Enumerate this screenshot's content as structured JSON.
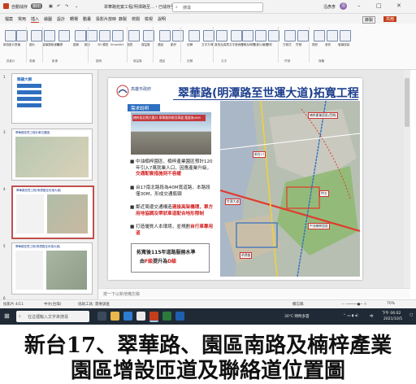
{
  "titlebar": {
    "autosave": "自動儲存",
    "toggle": "關閉",
    "doc_title": "翠華路拓寬工程(明潭路至…・已儲存至 此電腦",
    "search_placeholder": "搜尋",
    "user": "沿彥彥",
    "user_initials": "沿"
  },
  "menu": {
    "tabs": [
      "檔案",
      "常用",
      "插入",
      "繪圖",
      "設計",
      "轉場",
      "動畫",
      "投影片放映",
      "錄製",
      "校閱",
      "檢視",
      "說明"
    ],
    "right": "錄製",
    "share": "共用"
  },
  "ribbon": {
    "buttons": [
      "新投影片",
      "表格",
      "圖片",
      "螢幕擷取畫面",
      "相簿",
      "圖案",
      "圖示",
      "3D 模型",
      "SmartArt",
      "圖表",
      "增益集",
      "連結",
      "動作",
      "註解",
      "文字方塊",
      "頁首及頁尾",
      "文字藝術師",
      "日期及時間",
      "投影片編號",
      "物件",
      "方程式",
      "符號",
      "視訊",
      "音訊",
      "螢幕錄製"
    ],
    "groups": [
      "投影片",
      "表格",
      "影像",
      "圖例",
      "增益集",
      "連結",
      "註解",
      "文字",
      "符號",
      "媒體"
    ]
  },
  "thumbnails": [
    {
      "num": "1",
      "title": "競鐵大綱"
    },
    {
      "num": "3",
      "title": "翠華路拓寬工程計畫位置圖"
    },
    {
      "num": "4",
      "title": "翠華路拓寬工程(明潭路至世運大道)"
    },
    {
      "num": "5",
      "title": "翠華路拓寬工程(明潭路至世運大道)"
    },
    {
      "num": "6",
      "title": ""
    }
  ],
  "slide": {
    "logo_text": "高雄市政府",
    "title": "翠華路(明潭路至世運大道)拓寬工程",
    "section": "需求說明",
    "photo_caption": "楠梓段北側大路口 翠華路與現況車道 寬度為40M",
    "bullets": [
      {
        "text": "中油楠梓園區、楠梓產業園區預計120年引入7萬就業人口，因應產業升級，",
        "highlight": "交通配套措施刻不容緩"
      },
      {
        "text": "台17南北路段為40M寬道路，本路段僅30M，形成交通瓶頸",
        "highlight": ""
      },
      {
        "text": "鄰近周邊交通構造",
        "highlight": "連接高架橋環，單方用地協調及帶狀車道配合地形限制"
      },
      {
        "text": "打造優質人本環境，並規劃",
        "highlight": "自行車專用道"
      }
    ],
    "box_line1": "拓寬後115年道路服務水準",
    "box_line2_pre": "由",
    "box_line2_from": "F級",
    "box_line2_mid": "提升為",
    "box_line2_to": "D級",
    "map_labels": [
      "楠梓產業園區(西側)",
      "新台17",
      "特五",
      "中油楠梓園區",
      "世運大道",
      "明潭路"
    ]
  },
  "notes_placeholder": "按一下以新增備忘稿",
  "statusbar": {
    "slide_info": "投影片 4/11",
    "lang": "中文(台灣)",
    "accessibility": "協助工具: 需要調查",
    "notes": "備忘稿",
    "zoom": "70%"
  },
  "taskbar": {
    "search": "在這裡輸入文字來搜尋",
    "weather": "30°C 晴時多雲",
    "time": "下午 06:02",
    "date": "2021/10/5",
    "lang": "中"
  },
  "caption": {
    "line1": "新台17、翠華路、園區南路及楠梓產業",
    "line2": "園區增設匝道及聯絡道位置圖"
  },
  "colors": {
    "accent": "#c43e1c",
    "title_blue": "#1d3f8f",
    "section_blue": "#2e6fc0",
    "highlight_red": "#d32020",
    "taskbar": "#1f2a36"
  }
}
